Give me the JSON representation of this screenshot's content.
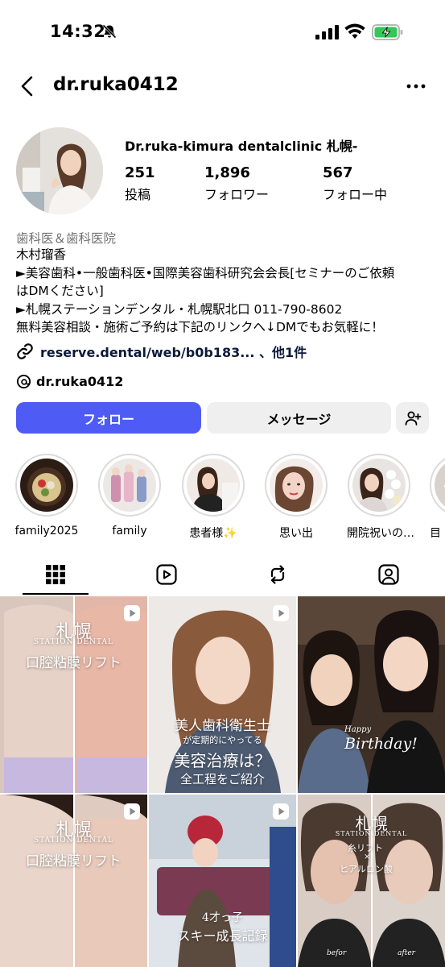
{
  "status_bar": {
    "time": "14:32"
  },
  "header": {
    "username": "dr.ruka0412"
  },
  "profile": {
    "display_name": "Dr.ruka-kimura dentalclinic 札幌-",
    "stats": [
      {
        "value": "251",
        "label": "投稿"
      },
      {
        "value": "1,896",
        "label": "フォロワー"
      },
      {
        "value": "567",
        "label": "フォロー中"
      }
    ],
    "category": "歯科医＆歯科医院",
    "bio_lines": [
      "木村瑠香",
      "►美容歯科•一般歯科医•国際美容歯科研究会会長[セミナーのご依頼",
      "はDMください]",
      "►札幌ステーションデンタル・札幌駅北口 011-790-8602",
      "無料美容相談・施術ご予約は下記のリンクへ↓DMでもお気軽に！"
    ],
    "link": "reserve.dental/web/b0b183... 、他1件",
    "threads_handle": "dr.ruka0412"
  },
  "buttons": {
    "follow": "フォロー",
    "message": "メッセージ"
  },
  "highlights": [
    {
      "label": "family2025"
    },
    {
      "label": "family"
    },
    {
      "label": "患者様✨"
    },
    {
      "label": "思い出"
    },
    {
      "label": "開院祝いの…"
    },
    {
      "label": "目"
    }
  ],
  "posts": [
    {
      "overlay": [
        "札幌",
        "STATION DENTAL",
        "口腔粘膜リフト"
      ]
    },
    {
      "overlay": [
        "美人歯科衛生士",
        "が定期的にやってる",
        "美容治療は？",
        "全工程をご紹介"
      ]
    },
    {
      "overlay": [
        "Happy",
        "Birthday!"
      ]
    },
    {
      "overlay": [
        "札幌",
        "STATION DENTAL",
        "口腔粘膜リフト"
      ]
    },
    {
      "overlay": [
        "4才っ子",
        "スキー成長記録"
      ]
    },
    {
      "overlay": [
        "札幌",
        "STATION DENTAL",
        "糸リフト",
        "×",
        "ヒアルロン酸",
        "befor",
        "after"
      ]
    }
  ],
  "colors": {
    "follow_button": "#4f5bf5",
    "secondary_button": "#efefef",
    "muted_text": "#737373",
    "battery": "#34c759"
  }
}
